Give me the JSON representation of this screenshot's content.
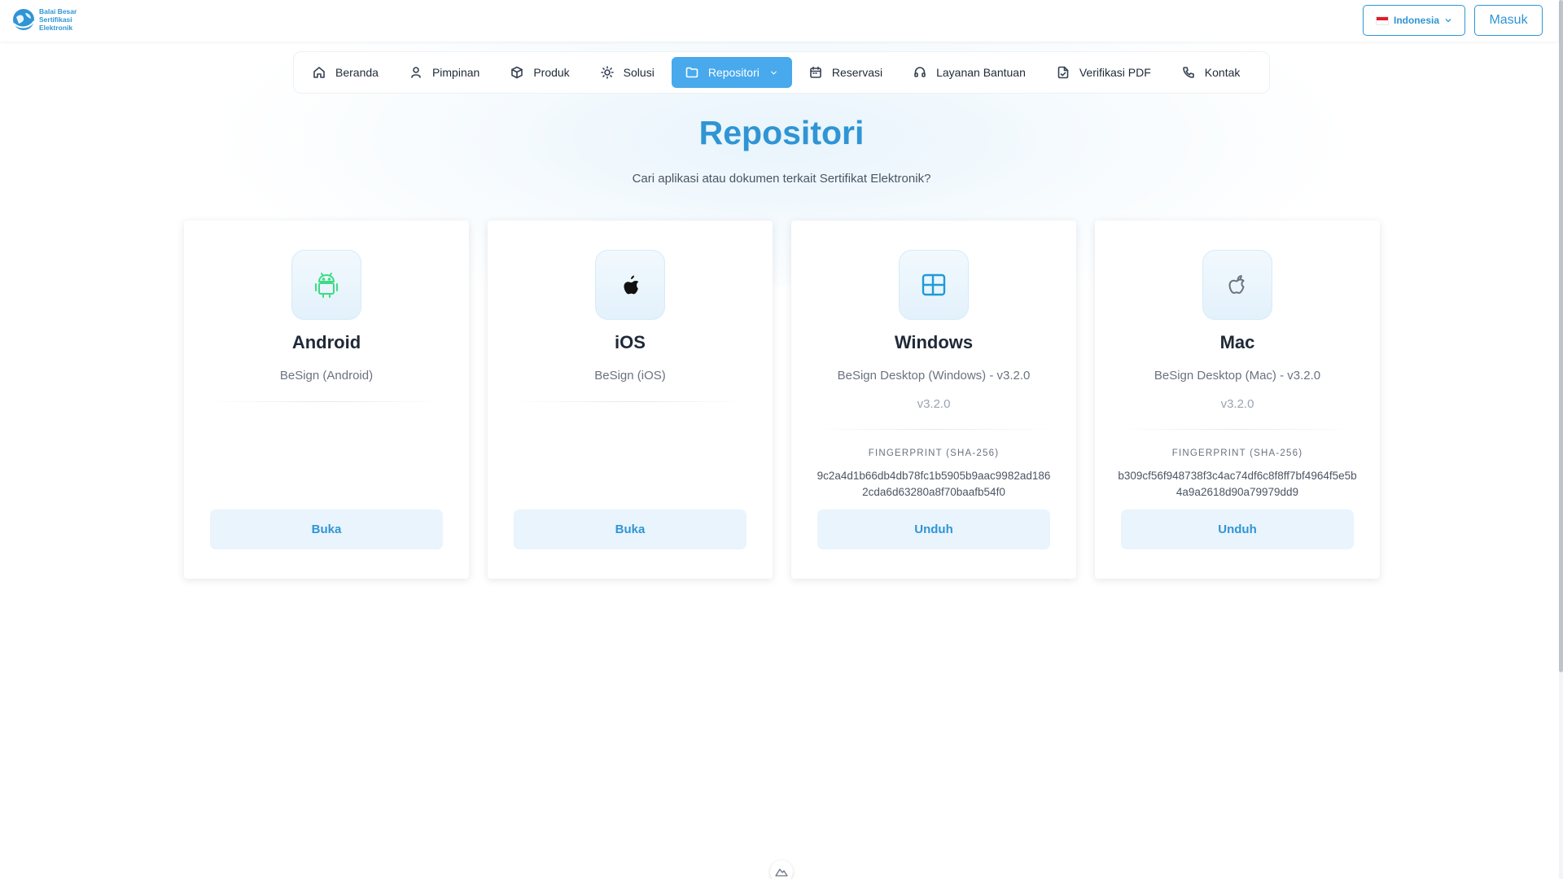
{
  "header": {
    "logo_lines": [
      "Balai Besar",
      "Sertifikasi",
      "Elektronik"
    ],
    "language_label": "Indonesia",
    "login_label": "Masuk"
  },
  "nav": {
    "items": [
      {
        "label": "Beranda",
        "icon": "home-icon"
      },
      {
        "label": "Pimpinan",
        "icon": "user-icon"
      },
      {
        "label": "Produk",
        "icon": "box-icon"
      },
      {
        "label": "Solusi",
        "icon": "lightbulb-icon"
      },
      {
        "label": "Repositori",
        "icon": "folder-icon",
        "active": true
      },
      {
        "label": "Reservasi",
        "icon": "calendar-icon"
      },
      {
        "label": "Layanan Bantuan",
        "icon": "headset-icon"
      },
      {
        "label": "Verifikasi PDF",
        "icon": "file-check-icon"
      },
      {
        "label": "Kontak",
        "icon": "phone-icon"
      }
    ]
  },
  "main": {
    "title": "Repositori",
    "subtitle": "Cari aplikasi atau dokumen terkait Sertifikat Elektronik?",
    "cards": [
      {
        "icon": "android-icon",
        "title": "Android",
        "description": "BeSign (Android)",
        "button": "Buka"
      },
      {
        "icon": "apple-icon",
        "title": "iOS",
        "description": "BeSign (iOS)",
        "button": "Buka"
      },
      {
        "icon": "windows-icon",
        "title": "Windows",
        "description": "BeSign Desktop (Windows) - v3.2.0",
        "version": "v3.2.0",
        "fingerprint_label": "FINGERPRINT (SHA-256)",
        "fingerprint": "9c2a4d1b66db4db78fc1b5905b9aac9982ad1862cda6d63280a8f70baafb54f0",
        "button": "Unduh"
      },
      {
        "icon": "apple-outline-icon",
        "title": "Mac",
        "description": "BeSign Desktop (Mac) - v3.2.0",
        "version": "v3.2.0",
        "fingerprint_label": "FINGERPRINT (SHA-256)",
        "fingerprint": "b309cf56f948738f3c4ac74df6c8f8ff7bf4964f5e5b4a9a2618d90a79979dd9",
        "button": "Unduh"
      }
    ]
  },
  "colors": {
    "brand": "#2f95d4",
    "nav_active": "#48a9ec",
    "android": "#3ddc84",
    "windows": "#1e9bd7"
  }
}
